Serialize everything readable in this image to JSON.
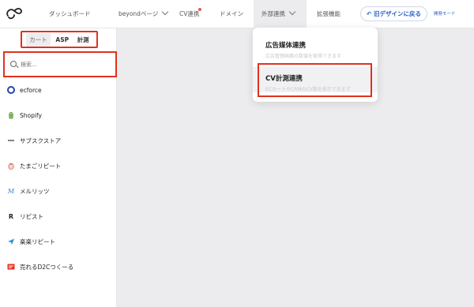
{
  "nav": {
    "items": [
      {
        "label": "ダッシュボード"
      },
      {
        "label": "beyondページ"
      },
      {
        "label": "CV連携"
      },
      {
        "label": "ドメイン"
      },
      {
        "label": "外部連携"
      },
      {
        "label": "拡張機能"
      }
    ],
    "old_design_label": "旧デザインに戻る",
    "dev_mode_label": "開発モード"
  },
  "sidebar": {
    "tabs": [
      {
        "label": "カート"
      },
      {
        "label": "ASP"
      },
      {
        "label": "計測"
      }
    ],
    "search": {
      "placeholder": "検索..."
    },
    "items": [
      {
        "label": "ecforce",
        "icon": "ecforce-icon"
      },
      {
        "label": "Shopify",
        "icon": "shopify-icon"
      },
      {
        "label": "サブスクストア",
        "icon": "subscstore-icon"
      },
      {
        "label": "たまごリピート",
        "icon": "tamago-repeat-icon"
      },
      {
        "label": "メルリッツ",
        "icon": "merritz-icon"
      },
      {
        "label": "リピスト",
        "icon": "ripist-icon"
      },
      {
        "label": "楽楽リピート",
        "icon": "rakuraku-repeat-icon"
      },
      {
        "label": "売れるD2Cつくーる",
        "icon": "ureru-d2c-icon"
      }
    ]
  },
  "dropdown": {
    "items": [
      {
        "title": "広告媒体連携",
        "desc": "広告管理画面の数値を取得できます"
      },
      {
        "title": "CV計測連携",
        "desc": "ECカートやCRMのCV数を表示できます"
      }
    ]
  },
  "colors": {
    "accent": "#2d63c8",
    "highlight_border": "#e0321f",
    "notification": "#e85a4f"
  }
}
